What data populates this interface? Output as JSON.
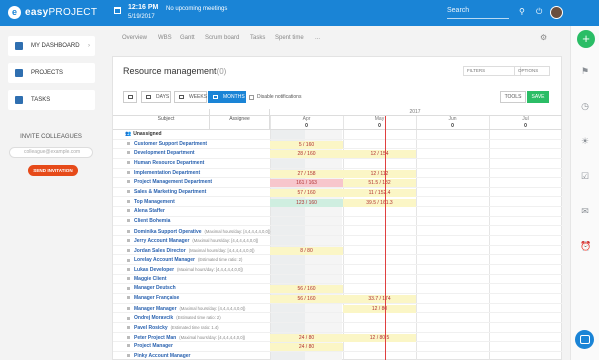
{
  "app": {
    "logo_letter": "e",
    "logo_bold": "easy",
    "logo_thin": "PROJECT",
    "time": "12:16 PM",
    "date": "5/19/2017",
    "meetings": "No upcoming meetings",
    "search_placeholder": "Search"
  },
  "sidebar": {
    "items": [
      {
        "label": "MY DASHBOARD",
        "icon": "dashboard-icon"
      },
      {
        "label": "PROJECTS",
        "icon": "projects-icon"
      },
      {
        "label": "TASKS",
        "icon": "tasks-icon"
      }
    ],
    "invite_title": "INVITE COLLEAGUES",
    "invite_placeholder": "colleague@example.com",
    "invite_button": "SEND INVITATION"
  },
  "tabs": [
    "Overview",
    "WBS",
    "Gantt",
    "Scrum board",
    "Tasks",
    "Spent time",
    "..."
  ],
  "panel": {
    "title": "Resource management",
    "count": "(0)",
    "filters": "FILTERS",
    "options": "OPTIONS",
    "days": "DAYS",
    "weeks": "WEEKS",
    "months": "MONTHS",
    "hide_notifications": "Disable notifications",
    "tools": "TOOLS",
    "save": "SAVE"
  },
  "gantt": {
    "subject_header": "Subject",
    "assignee_header": "Assignee",
    "year": "2017",
    "months": [
      "Apr",
      "May",
      "Jun",
      "Jul"
    ],
    "month_totals": [
      "0",
      "0",
      "0",
      "0"
    ],
    "rows": [
      {
        "name": "Unassigned",
        "type": "group",
        "apr": "",
        "may": ""
      },
      {
        "name": "Customer Support Department",
        "type": "dept",
        "apr": "5 / 160",
        "apr_cls": "y",
        "may": ""
      },
      {
        "name": "Development Department",
        "type": "dept",
        "apr": "28 / 160",
        "apr_cls": "y",
        "may": "12 / 154",
        "may_cls": "y"
      },
      {
        "name": "Human Resource Department",
        "type": "dept",
        "apr": "",
        "may": ""
      },
      {
        "name": "Implementation Department",
        "type": "dept",
        "apr": "27 / 158",
        "apr_cls": "y",
        "may": "12 / 112",
        "may_cls": "y"
      },
      {
        "name": "Project Management Department",
        "type": "dept",
        "apr": "161 / 163",
        "apr_cls": "r",
        "may": "51.5 / 182",
        "may_cls": "y"
      },
      {
        "name": "Sales & Marketing Department",
        "type": "dept",
        "apr": "57 / 160",
        "apr_cls": "y",
        "may": "11 / 152.4",
        "may_cls": "y"
      },
      {
        "name": "Top Management",
        "type": "dept",
        "apr": "123 / 160",
        "apr_cls": "g",
        "may": "39.5 / 161.3",
        "may_cls": "y"
      },
      {
        "name": "Alena Staffer",
        "type": "user",
        "note": "",
        "apr": "",
        "may": ""
      },
      {
        "name": "Client Bohemia",
        "type": "user",
        "note": "",
        "apr": "",
        "may": ""
      },
      {
        "name": "Dominika Support Operative",
        "type": "user",
        "note": "(Maximal hours/day: [4,4,4,4,4,0,0])",
        "apr": "",
        "may": ""
      },
      {
        "name": "Jerry Account Manager",
        "type": "user",
        "note": "(Maximal hours/day: [4,4,4,4,4,0,0])",
        "apr": "",
        "may": ""
      },
      {
        "name": "Jordan Sales Director",
        "type": "user",
        "note": "(Maximal hours/day: [4,4,4,4,4,0,0])",
        "apr": "8 / 80",
        "apr_cls": "y",
        "may": ""
      },
      {
        "name": "Lorelay Account Manager",
        "type": "user",
        "note": "(Estimated time ratio: 2)",
        "apr": "",
        "may": ""
      },
      {
        "name": "Lukas Developer",
        "type": "user",
        "note": "(Maximal hours/day: [4,4,4,4,4,0,0])",
        "apr": "",
        "may": ""
      },
      {
        "name": "Maggie Client",
        "type": "user",
        "note": "",
        "apr": "",
        "may": ""
      },
      {
        "name": "Manager Deutsch",
        "type": "user",
        "note": "",
        "apr": "56 / 160",
        "apr_cls": "y",
        "may": ""
      },
      {
        "name": "Manager Française",
        "type": "user",
        "note": "",
        "apr": "56 / 160",
        "apr_cls": "y",
        "may": "33.7 / 174",
        "may_cls": "y"
      },
      {
        "name": "Manager Manager",
        "type": "user",
        "note": "(Maximal hours/day: [4,4,4,4,4,0,0])",
        "apr": "",
        "may": "12 / 80",
        "may_cls": "y"
      },
      {
        "name": "Ondrej Moravcik",
        "type": "user",
        "note": "(Estimated time ratio: 2)",
        "apr": "",
        "may": ""
      },
      {
        "name": "Pavel Rosicky",
        "type": "user",
        "note": "(Estimated time ratio: 1.4)",
        "apr": "",
        "may": ""
      },
      {
        "name": "Peter Project Man",
        "type": "user",
        "note": "(Maximal hours/day: [4,4,4,4,4,0,0])",
        "apr": "24 / 80",
        "apr_cls": "y",
        "may": "12 / 80.5",
        "may_cls": "y"
      },
      {
        "name": "Project Manager",
        "type": "user",
        "note": "",
        "apr": "24 / 80",
        "apr_cls": "y",
        "may": ""
      },
      {
        "name": "Pinky Account Manager",
        "type": "user",
        "note": "",
        "apr": "",
        "may": ""
      }
    ]
  },
  "rail": {
    "plus": "+",
    "icons": [
      "flag-icon",
      "clock-icon",
      "bulb-icon",
      "checklist-icon",
      "chat-bubble-icon",
      "alarm-icon"
    ]
  },
  "colors": {
    "brand": "#1a84d6",
    "save": "#2bbd66",
    "invite": "#e64a19",
    "today_line": "#e04040"
  }
}
